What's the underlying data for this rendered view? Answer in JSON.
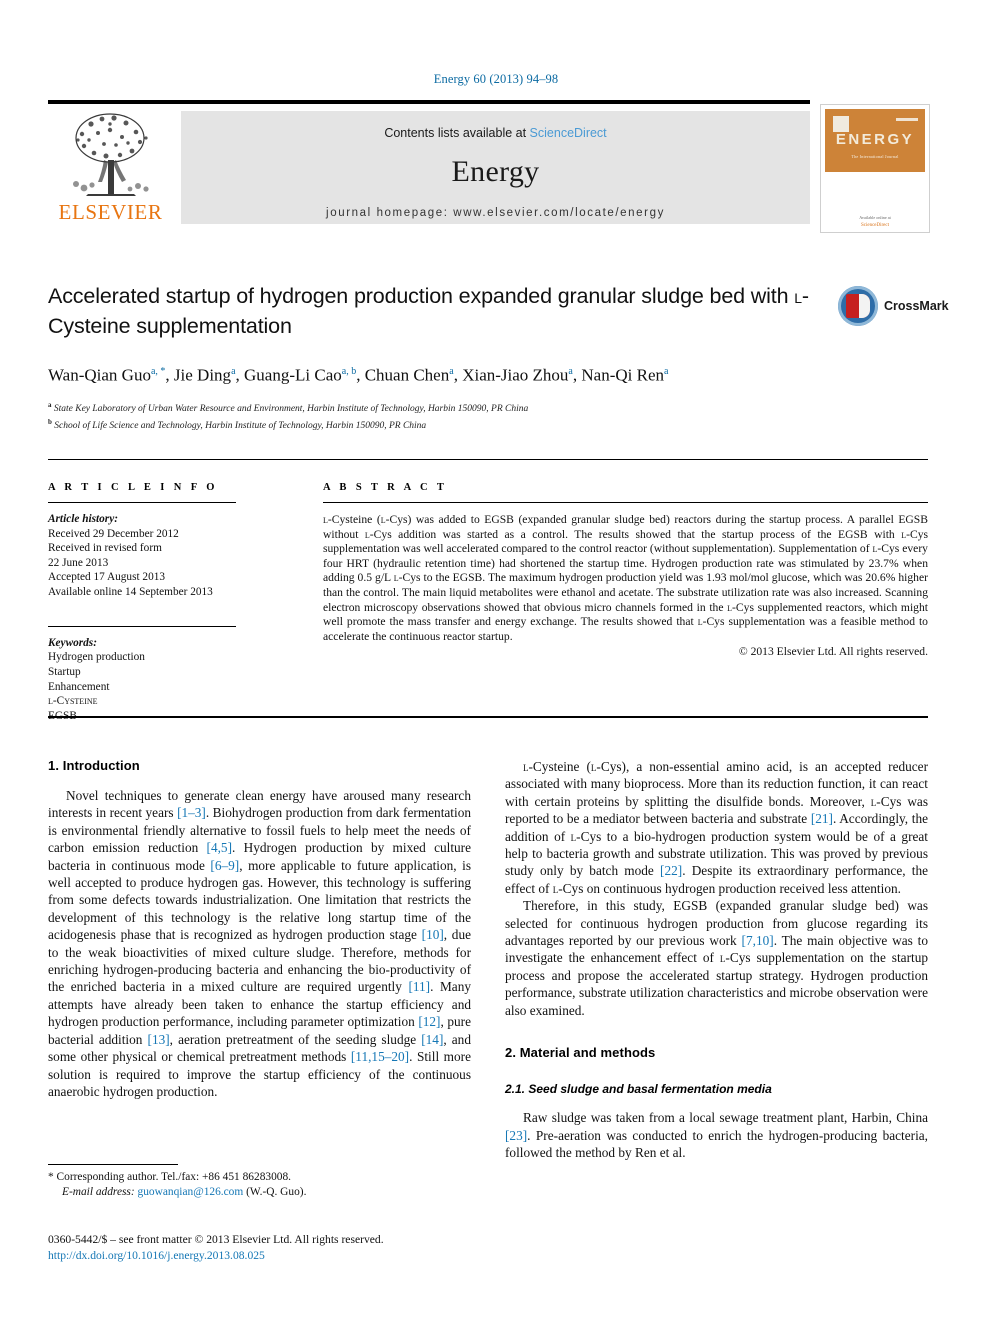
{
  "running_head": "Energy 60 (2013) 94–98",
  "masthead": {
    "publisher_name": "ELSEVIER",
    "contents_prefix": "Contents lists available at ",
    "sciencedirect": "ScienceDirect",
    "journal_name": "Energy",
    "homepage": "journal homepage: www.elsevier.com/locate/energy"
  },
  "cover": {
    "title": "ENERGY",
    "subtitle": "The International Journal",
    "bottom_note": "Available online at",
    "sd": "ScienceDirect"
  },
  "article": {
    "title_line1": "Accelerated startup of hydrogen production expanded granular sludge",
    "title_line2_pre": "bed with ",
    "title_line2_sc": "l",
    "title_line2_post": "-Cysteine supplementation",
    "authors": [
      {
        "name": "Wan-Qian Guo",
        "marks": "a, *"
      },
      {
        "name": "Jie Ding",
        "marks": "a"
      },
      {
        "name": "Guang-Li Cao",
        "marks": "a, b"
      },
      {
        "name": "Chuan Chen",
        "marks": "a"
      },
      {
        "name": "Xian-Jiao Zhou",
        "marks": "a"
      },
      {
        "name": "Nan-Qi Ren",
        "marks": "a"
      }
    ],
    "affiliations": [
      {
        "mark": "a",
        "text": "State Key Laboratory of Urban Water Resource and Environment, Harbin Institute of Technology, Harbin 150090, PR China"
      },
      {
        "mark": "b",
        "text": "School of Life Science and Technology, Harbin Institute of Technology, Harbin 150090, PR China"
      }
    ],
    "crossmark_label": "CrossMark"
  },
  "article_info": {
    "heading": "A R T I C L E   I N F O",
    "history_label": "Article history:",
    "history": [
      "Received 29 December 2012",
      "Received in revised form",
      "22 June 2013",
      "Accepted 17 August 2013",
      "Available online 14 September 2013"
    ],
    "keywords_label": "Keywords:",
    "keywords": [
      "Hydrogen production",
      "Startup",
      "Enhancement",
      "l-Cysteine",
      "EGSB"
    ]
  },
  "abstract": {
    "heading": "A B S T R A C T",
    "text": "l-Cysteine (l-Cys) was added to EGSB (expanded granular sludge bed) reactors during the startup process. A parallel EGSB without l-Cys addition was started as a control. The results showed that the startup process of the EGSB with l-Cys supplementation was well accelerated compared to the control reactor (without supplementation). Supplementation of l-Cys every four HRT (hydraulic retention time) had shortened the startup time. Hydrogen production rate was stimulated by 23.7% when adding 0.5 g/L l-Cys to the EGSB. The maximum hydrogen production yield was 1.93 mol/mol glucose, which was 20.6% higher than the control. The main liquid metabolites were ethanol and acetate. The substrate utilization rate was also increased. Scanning electron microscopy observations showed that obvious micro channels formed in the l-Cys supplemented reactors, which might well promote the mass transfer and energy exchange. The results showed that l-Cys supplementation was a feasible method to accelerate the continuous reactor startup.",
    "copyright": "© 2013 Elsevier Ltd. All rights reserved."
  },
  "body": {
    "h_intro": "1.  Introduction",
    "p_intro_1": "Novel techniques to generate clean energy have aroused many research interests in recent years [1–3]. Biohydrogen production from dark fermentation is environmental friendly alternative to fossil fuels to help meet the needs of carbon emission reduction [4,5]. Hydrogen production by mixed culture bacteria in continuous mode [6–9], more applicable to future application, is well accepted to produce hydrogen gas. However, this technology is suffering from some defects towards industrialization. One limitation that restricts the development of this technology is the relative long startup time of the acidogenesis phase that is recognized as hydrogen production stage [10], due to the weak bioactivities of mixed culture sludge. Therefore, methods for enriching hydrogen-producing bacteria and enhancing the bio-productivity of the enriched bacteria in a mixed culture are required urgently [11]. Many attempts have already been taken to enhance the startup efficiency and hydrogen production performance, including parameter optimization [12], pure bacterial addition [13], aeration pretreatment of the seeding sludge [14], and some other physical or chemical pretreatment methods [11,15–20]. Still more solution is required to improve the startup efficiency of the continuous anaerobic hydrogen production.",
    "p_intro_2": "l-Cysteine (l-Cys), a non-essential amino acid, is an accepted reducer associated with many bioprocess. More than its reduction function, it can react with certain proteins by splitting the disulfide bonds. Moreover, l-Cys was reported to be a mediator between bacteria and substrate [21]. Accordingly, the addition of l-Cys to a bio-hydrogen production system would be of a great help to bacteria growth and substrate utilization. This was proved by previous study only by batch mode [22]. Despite its extraordinary performance, the effect of l-Cys on continuous hydrogen production received less attention.",
    "p_intro_3": "Therefore, in this study, EGSB (expanded granular sludge bed) was selected for continuous hydrogen production from glucose regarding its advantages reported by our previous work [7,10]. The main objective was to investigate the enhancement effect of l-Cys supplementation on the startup process and propose the accelerated startup strategy. Hydrogen production performance, substrate utilization characteristics and microbe observation were also examined.",
    "h_methods": "2.  Material and methods",
    "h_methods_sub": "2.1.  Seed sludge and basal fermentation media",
    "p_methods_1": "Raw sludge was taken from a local sewage treatment plant, Harbin, China [23]. Pre-aeration was conducted to enrich the hydrogen-producing bacteria, followed the method by Ren et al."
  },
  "footer": {
    "corresponding": "* Corresponding author. Tel./fax: +86 451 86283008.",
    "email_label": "E-mail address:",
    "email": "guowanqian@126.com",
    "email_suffix": " (W.-Q. Guo).",
    "issn_line": "0360-5442/$ – see front matter © 2013 Elsevier Ltd. All rights reserved.",
    "doi": "http://dx.doi.org/10.1016/j.energy.2013.08.025"
  },
  "colors": {
    "link": "#1577b5",
    "running_head": "#0b6aa2",
    "elsevier_orange": "#e87511",
    "sciencedirect": "#4a9ad4"
  }
}
